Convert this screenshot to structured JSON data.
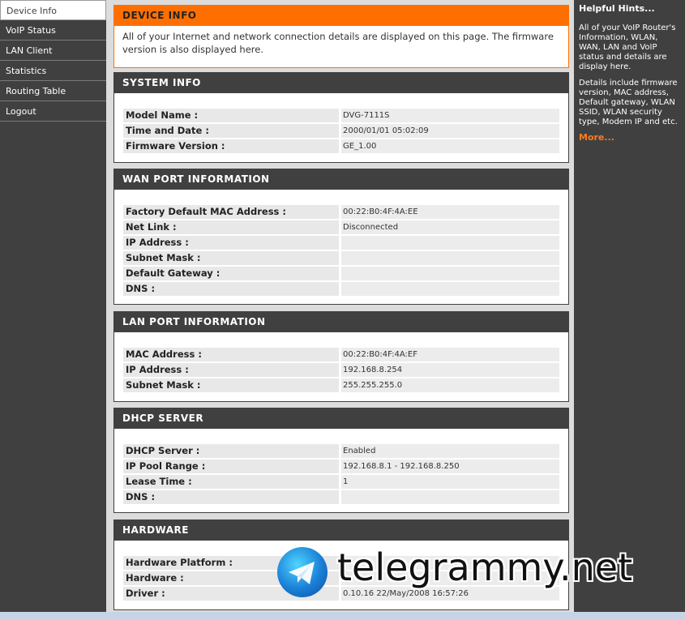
{
  "nav": {
    "items": [
      {
        "label": "Device Info"
      },
      {
        "label": "VoIP Status"
      },
      {
        "label": "LAN Client"
      },
      {
        "label": "Statistics"
      },
      {
        "label": "Routing Table"
      },
      {
        "label": "Logout"
      }
    ]
  },
  "device_info": {
    "title": "DEVICE INFO",
    "description": "All of your Internet and network connection details are displayed on this page. The firmware version is also displayed here."
  },
  "system_info": {
    "title": "SYSTEM INFO",
    "rows": [
      {
        "label": "Model Name :",
        "value": "DVG-7111S"
      },
      {
        "label": "Time and Date :",
        "value": "2000/01/01 05:02:09"
      },
      {
        "label": "Firmware Version :",
        "value": "GE_1.00"
      }
    ]
  },
  "wan": {
    "title": "WAN PORT INFORMATION",
    "rows": [
      {
        "label": "Factory Default MAC Address :",
        "value": "00:22:B0:4F:4A:EE"
      },
      {
        "label": "Net Link :",
        "value": "Disconnected"
      },
      {
        "label": "IP Address :",
        "value": ""
      },
      {
        "label": "Subnet Mask :",
        "value": ""
      },
      {
        "label": "Default Gateway :",
        "value": ""
      },
      {
        "label": "DNS :",
        "value": ""
      }
    ]
  },
  "lan": {
    "title": "LAN PORT INFORMATION",
    "rows": [
      {
        "label": "MAC Address :",
        "value": "00:22:B0:4F:4A:EF"
      },
      {
        "label": "IP Address :",
        "value": "192.168.8.254"
      },
      {
        "label": "Subnet Mask :",
        "value": "255.255.255.0"
      }
    ]
  },
  "dhcp": {
    "title": "DHCP SERVER",
    "rows": [
      {
        "label": "DHCP Server :",
        "value": "Enabled"
      },
      {
        "label": "IP Pool Range :",
        "value": "192.168.8.1 - 192.168.8.250"
      },
      {
        "label": "Lease Time :",
        "value": "1"
      },
      {
        "label": "DNS :",
        "value": ""
      }
    ]
  },
  "hardware": {
    "title": "HARDWARE",
    "rows": [
      {
        "label": "Hardware Platform :",
        "value": ""
      },
      {
        "label": "Hardware :",
        "value": ""
      },
      {
        "label": "Driver :",
        "value": "0.10.16 22/May/2008 16:57:26"
      }
    ]
  },
  "hints": {
    "title": "Helpful Hints...",
    "text1": "All of your VoIP Router's Information, WLAN, WAN, LAN and VoIP status and details are display here.",
    "text2": "Details include firmware version, MAC address, Default gateway, WLAN SSID, WLAN security type, Modem IP and etc.",
    "more": "More..."
  },
  "watermark": {
    "text": "telegrammy.net",
    "icon": "telegram-logo-icon"
  }
}
